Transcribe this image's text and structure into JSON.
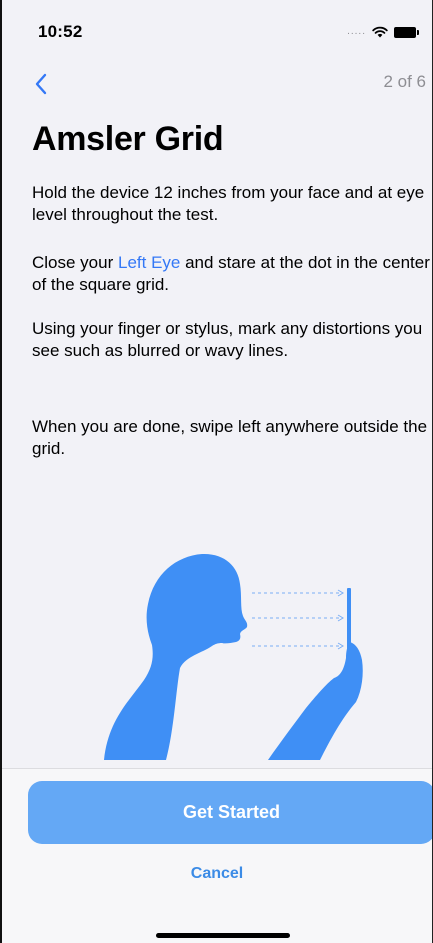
{
  "status": {
    "time": "10:52",
    "signal_dots": "....."
  },
  "nav": {
    "step_label": "2 of 6"
  },
  "title": "Amsler Grid",
  "instructions": {
    "p1": "Hold the device 12 inches from your face and at eye level throughout the test.",
    "p2_prefix": "Close your ",
    "p2_link": "Left Eye",
    "p2_suffix": " and stare at the dot in the center of the square grid.",
    "p3": "Using your finger or stylus, mark any distortions you see such as blurred or wavy lines.",
    "p4": "When you are done, swipe left anywhere outside the grid."
  },
  "buttons": {
    "primary": "Get Started",
    "cancel": "Cancel"
  },
  "colors": {
    "accent": "#3478f6",
    "primary_button": "#64a8f5",
    "illustration": "#3f8ff5",
    "background": "#f2f2f7"
  }
}
